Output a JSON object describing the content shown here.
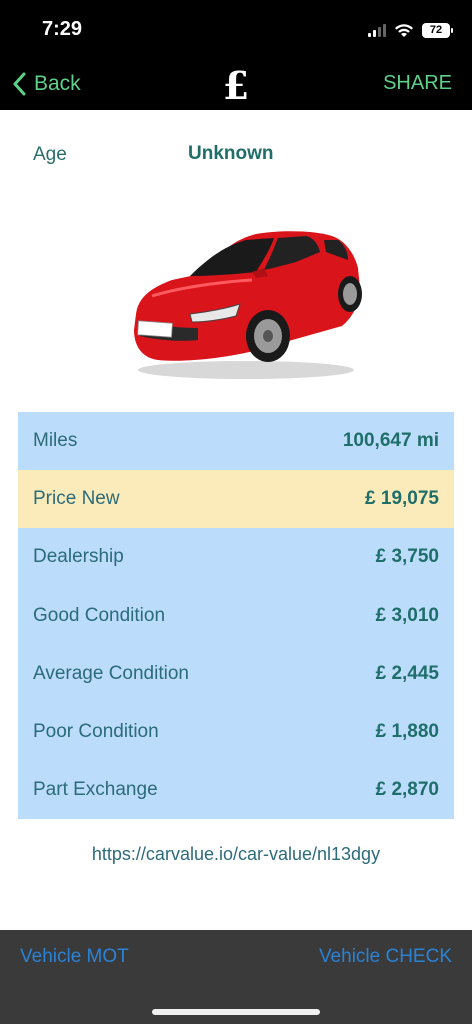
{
  "status": {
    "time": "7:29",
    "battery": "72"
  },
  "nav": {
    "back_label": "Back",
    "title": "£",
    "share_label": "SHARE"
  },
  "age": {
    "label": "Age",
    "value": "Unknown"
  },
  "car_image": {
    "description_icon": "red-hatchback-car-image",
    "color": "#e0161e"
  },
  "values": {
    "miles": {
      "label": "Miles",
      "value": "100,647 mi"
    },
    "price_new": {
      "label": "Price New",
      "value": "£ 19,075"
    },
    "dealership": {
      "label": "Dealership",
      "value": "£ 3,750"
    },
    "good": {
      "label": "Good Condition",
      "value": "£ 3,010"
    },
    "average": {
      "label": "Average Condition",
      "value": "£ 2,445"
    },
    "poor": {
      "label": "Poor Condition",
      "value": "£ 1,880"
    },
    "part_exchange": {
      "label": "Part Exchange",
      "value": "£ 2,870"
    }
  },
  "url": "https://carvalue.io/car-value/nl13dgy",
  "bottom": {
    "left_label": "Vehicle MOT",
    "right_label": "Vehicle CHECK"
  },
  "colors": {
    "accent_green": "#5fd08a",
    "table_blue": "#bcdcfb",
    "highlight_yellow": "#fbebba",
    "link_blue": "#2a82d6",
    "text_teal": "#1f6e6a"
  }
}
